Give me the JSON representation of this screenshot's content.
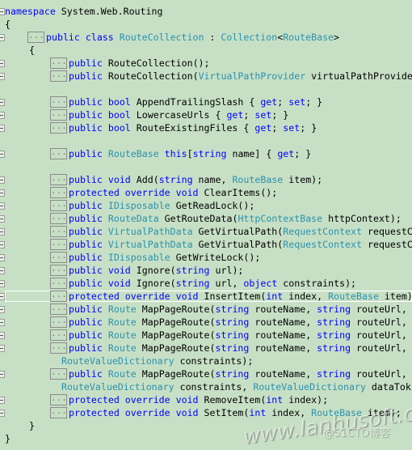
{
  "editor": {
    "highlighted_line": 22,
    "collapsed_glyph": "...",
    "colors": {
      "keyword": "#0000ff",
      "type": "#2b91af",
      "text": "#000000",
      "background": "#c7e0c5"
    },
    "lines": [
      {
        "level": 0,
        "marker": true,
        "segs": [
          [
            "k",
            "namespace"
          ],
          [
            "p",
            " System.Web.Routing"
          ]
        ]
      },
      {
        "level": 0,
        "segs": [
          [
            "p",
            "{"
          ]
        ]
      },
      {
        "level": 1,
        "box": true,
        "marker": true,
        "segs": [
          [
            "k",
            "public class "
          ],
          [
            "t",
            "RouteCollection"
          ],
          [
            "p",
            " : "
          ],
          [
            "t",
            "Collection"
          ],
          [
            "p",
            "<"
          ],
          [
            "t",
            "RouteBase"
          ],
          [
            "p",
            ">"
          ]
        ]
      },
      {
        "level": 1,
        "segs": [
          [
            "p",
            "{"
          ]
        ]
      },
      {
        "level": 2,
        "box": true,
        "marker": true,
        "segs": [
          [
            "k",
            "public "
          ],
          [
            "p",
            "RouteCollection();"
          ]
        ]
      },
      {
        "level": 2,
        "box": true,
        "marker": true,
        "segs": [
          [
            "k",
            "public "
          ],
          [
            "p",
            "RouteCollection("
          ],
          [
            "t",
            "VirtualPathProvider"
          ],
          [
            "p",
            " virtualPathProvide"
          ]
        ]
      },
      {
        "level": 2,
        "segs": []
      },
      {
        "level": 2,
        "box": true,
        "marker": true,
        "segs": [
          [
            "k",
            "public bool "
          ],
          [
            "p",
            "AppendTrailingSlash { "
          ],
          [
            "k",
            "get"
          ],
          [
            "p",
            "; "
          ],
          [
            "k",
            "set"
          ],
          [
            "p",
            "; }"
          ]
        ]
      },
      {
        "level": 2,
        "box": true,
        "marker": true,
        "segs": [
          [
            "k",
            "public bool "
          ],
          [
            "p",
            "LowercaseUrls { "
          ],
          [
            "k",
            "get"
          ],
          [
            "p",
            "; "
          ],
          [
            "k",
            "set"
          ],
          [
            "p",
            "; }"
          ]
        ]
      },
      {
        "level": 2,
        "box": true,
        "marker": true,
        "segs": [
          [
            "k",
            "public bool "
          ],
          [
            "p",
            "RouteExistingFiles { "
          ],
          [
            "k",
            "get"
          ],
          [
            "p",
            "; "
          ],
          [
            "k",
            "set"
          ],
          [
            "p",
            "; }"
          ]
        ]
      },
      {
        "level": 2,
        "segs": []
      },
      {
        "level": 2,
        "box": true,
        "marker": true,
        "segs": [
          [
            "k",
            "public "
          ],
          [
            "t",
            "RouteBase"
          ],
          [
            "k",
            " this"
          ],
          [
            "p",
            "["
          ],
          [
            "k",
            "string"
          ],
          [
            "p",
            " name] { "
          ],
          [
            "k",
            "get"
          ],
          [
            "p",
            "; }"
          ]
        ]
      },
      {
        "level": 2,
        "segs": []
      },
      {
        "level": 2,
        "box": true,
        "marker": true,
        "segs": [
          [
            "k",
            "public void "
          ],
          [
            "p",
            "Add("
          ],
          [
            "k",
            "string"
          ],
          [
            "p",
            " name, "
          ],
          [
            "t",
            "RouteBase"
          ],
          [
            "p",
            " item);"
          ]
        ]
      },
      {
        "level": 2,
        "box": true,
        "marker": true,
        "segs": [
          [
            "k",
            "protected override void "
          ],
          [
            "p",
            "ClearItems();"
          ]
        ]
      },
      {
        "level": 2,
        "box": true,
        "marker": true,
        "segs": [
          [
            "k",
            "public "
          ],
          [
            "t",
            "IDisposable"
          ],
          [
            "p",
            " GetReadLock();"
          ]
        ]
      },
      {
        "level": 2,
        "box": true,
        "marker": true,
        "segs": [
          [
            "k",
            "public "
          ],
          [
            "t",
            "RouteData"
          ],
          [
            "p",
            " GetRouteData("
          ],
          [
            "t",
            "HttpContextBase"
          ],
          [
            "p",
            " httpContext);"
          ]
        ]
      },
      {
        "level": 2,
        "box": true,
        "marker": true,
        "segs": [
          [
            "k",
            "public "
          ],
          [
            "t",
            "VirtualPathData"
          ],
          [
            "p",
            " GetVirtualPath("
          ],
          [
            "t",
            "RequestContext"
          ],
          [
            "p",
            " requestC"
          ]
        ]
      },
      {
        "level": 2,
        "box": true,
        "marker": true,
        "segs": [
          [
            "k",
            "public "
          ],
          [
            "t",
            "VirtualPathData"
          ],
          [
            "p",
            " GetVirtualPath("
          ],
          [
            "t",
            "RequestContext"
          ],
          [
            "p",
            " requestC"
          ]
        ]
      },
      {
        "level": 2,
        "box": true,
        "marker": true,
        "segs": [
          [
            "k",
            "public "
          ],
          [
            "t",
            "IDisposable"
          ],
          [
            "p",
            " GetWriteLock();"
          ]
        ]
      },
      {
        "level": 2,
        "box": true,
        "marker": true,
        "segs": [
          [
            "k",
            "public void "
          ],
          [
            "p",
            "Ignore("
          ],
          [
            "k",
            "string"
          ],
          [
            "p",
            " url);"
          ]
        ]
      },
      {
        "level": 2,
        "box": true,
        "marker": true,
        "segs": [
          [
            "k",
            "public void "
          ],
          [
            "p",
            "Ignore("
          ],
          [
            "k",
            "string"
          ],
          [
            "p",
            " url, "
          ],
          [
            "k",
            "object"
          ],
          [
            "p",
            " constraints);"
          ]
        ]
      },
      {
        "level": 2,
        "box": true,
        "marker": true,
        "segs": [
          [
            "k",
            "protected override void "
          ],
          [
            "p",
            "InsertItem("
          ],
          [
            "k",
            "int"
          ],
          [
            "p",
            " index, "
          ],
          [
            "t",
            "RouteBase"
          ],
          [
            "p",
            " item);"
          ]
        ]
      },
      {
        "level": 2,
        "box": true,
        "marker": true,
        "segs": [
          [
            "k",
            "public "
          ],
          [
            "t",
            "Route"
          ],
          [
            "p",
            " MapPageRoute("
          ],
          [
            "k",
            "string"
          ],
          [
            "p",
            " routeName, "
          ],
          [
            "k",
            "string"
          ],
          [
            "p",
            " routeUrl,"
          ]
        ]
      },
      {
        "level": 2,
        "box": true,
        "marker": true,
        "segs": [
          [
            "k",
            "public "
          ],
          [
            "t",
            "Route"
          ],
          [
            "p",
            " MapPageRoute("
          ],
          [
            "k",
            "string"
          ],
          [
            "p",
            " routeName, "
          ],
          [
            "k",
            "string"
          ],
          [
            "p",
            " routeUrl,"
          ]
        ]
      },
      {
        "level": 2,
        "box": true,
        "marker": true,
        "segs": [
          [
            "k",
            "public "
          ],
          [
            "t",
            "Route"
          ],
          [
            "p",
            " MapPageRoute("
          ],
          [
            "k",
            "string"
          ],
          [
            "p",
            " routeName, "
          ],
          [
            "k",
            "string"
          ],
          [
            "p",
            " routeUrl,"
          ]
        ]
      },
      {
        "level": 2,
        "box": true,
        "marker": true,
        "segs": [
          [
            "k",
            "public "
          ],
          [
            "t",
            "Route"
          ],
          [
            "p",
            " MapPageRoute("
          ],
          [
            "k",
            "string"
          ],
          [
            "p",
            " routeName, "
          ],
          [
            "k",
            "string"
          ],
          [
            "p",
            " routeUrl,"
          ]
        ]
      },
      {
        "level": "cont",
        "segs": [
          [
            "t",
            "RouteValueDictionary"
          ],
          [
            "p",
            " constraints);"
          ]
        ]
      },
      {
        "level": 2,
        "box": true,
        "marker": true,
        "segs": [
          [
            "k",
            "public "
          ],
          [
            "t",
            "Route"
          ],
          [
            "p",
            " MapPageRoute("
          ],
          [
            "k",
            "string"
          ],
          [
            "p",
            " routeName, "
          ],
          [
            "k",
            "string"
          ],
          [
            "p",
            " routeUrl,"
          ]
        ]
      },
      {
        "level": "cont",
        "segs": [
          [
            "t",
            "RouteValueDictionary"
          ],
          [
            "p",
            " constraints, "
          ],
          [
            "t",
            "RouteValueDictionary"
          ],
          [
            "p",
            " dataTok"
          ]
        ]
      },
      {
        "level": 2,
        "box": true,
        "marker": true,
        "segs": [
          [
            "k",
            "protected override void "
          ],
          [
            "p",
            "RemoveItem("
          ],
          [
            "k",
            "int"
          ],
          [
            "p",
            " index);"
          ]
        ]
      },
      {
        "level": 2,
        "box": true,
        "marker": true,
        "segs": [
          [
            "k",
            "protected override void "
          ],
          [
            "p",
            "SetItem("
          ],
          [
            "k",
            "int"
          ],
          [
            "p",
            " index, "
          ],
          [
            "t",
            "RouteBase"
          ],
          [
            "p",
            " item);"
          ]
        ]
      },
      {
        "level": 1,
        "segs": [
          [
            "p",
            "}"
          ]
        ]
      },
      {
        "level": 0,
        "segs": [
          [
            "p",
            "}"
          ]
        ]
      }
    ]
  },
  "watermark": {
    "site": "www.lanhusoft.com",
    "blog": "@51CTO博客"
  }
}
